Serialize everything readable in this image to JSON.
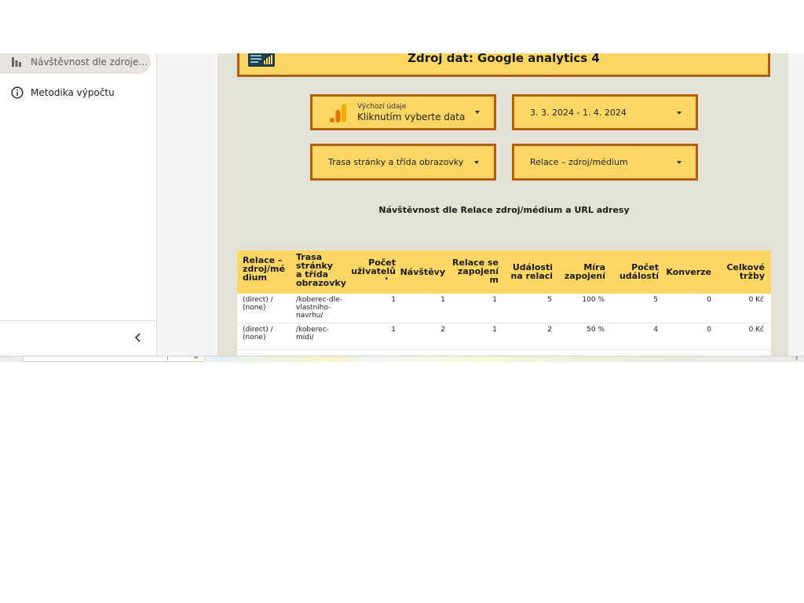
{
  "sidebar": {
    "items": [
      {
        "label": "Návštěvnost dle zdroje a...",
        "icon": "bar-chart-icon",
        "active": true
      },
      {
        "label": "Metodika výpočtu",
        "icon": "info-icon",
        "active": false
      }
    ],
    "collapse_icon": "chevron-left-icon"
  },
  "report": {
    "banner": {
      "title": "Zdroj dat: Google analytics 4",
      "colors": {
        "fill": "#fdd663",
        "border": "#b45d0e"
      }
    },
    "controls": {
      "data_source": {
        "small_label": "Výchozí údaje",
        "value": "Kliknutím vyberte data Go"
      },
      "date_range": {
        "value": "3. 3. 2024 - 1. 4. 2024"
      },
      "page_path": {
        "value": "Trasa stránky a třída obrazovky"
      },
      "session_source": {
        "value": "Relace – zdroj/médium"
      }
    },
    "table": {
      "title": "Návštěvnost dle Relace zdroj/médium a URL adresy",
      "columns": [
        "Relace – zdroj/médium",
        "Trasa stránky a třída obrazovky",
        "Počet uživatelů",
        "Návštěvy",
        "Relace se zapojením",
        "Události na relaci",
        "Míra zapojení",
        "Počet událostí",
        "Konverze",
        "Celkové tržby"
      ],
      "column_lines": [
        [
          "Relace –",
          "zdroj/mé",
          "dium"
        ],
        [
          "Trasa",
          "stránky",
          "a třída",
          "obrazovky"
        ],
        [
          "Počet",
          "uživatelů"
        ],
        [
          "Návštěvy"
        ],
        [
          "Relace se",
          "zapojení",
          "m"
        ],
        [
          "Události",
          "na relaci"
        ],
        [
          "Míra",
          "zapojení"
        ],
        [
          "Počet",
          "událostí"
        ],
        [
          "Konverze"
        ],
        [
          "Celkové",
          "tržby"
        ]
      ],
      "sort_indicator": "▾",
      "rows": [
        {
          "source_lines": [
            "(direct) /",
            "(none)"
          ],
          "path_lines": [
            "/koberec-dle-",
            "vlastniho-",
            "navrhu/"
          ],
          "users": "1",
          "visits": "1",
          "engaged": "1",
          "events_per_session": "5",
          "engagement_rate": "100 %",
          "events": "5",
          "conversions": "0",
          "revenue": "0 Kč"
        },
        {
          "source_lines": [
            "(direct) /",
            "(none)"
          ],
          "path_lines": [
            "/koberec-",
            "midi/"
          ],
          "users": "1",
          "visits": "2",
          "engaged": "1",
          "events_per_session": "2",
          "engagement_rate": "50 %",
          "events": "4",
          "conversions": "0",
          "revenue": "0 Kč"
        }
      ]
    }
  },
  "taskbar": {
    "corner_text": "↑"
  }
}
